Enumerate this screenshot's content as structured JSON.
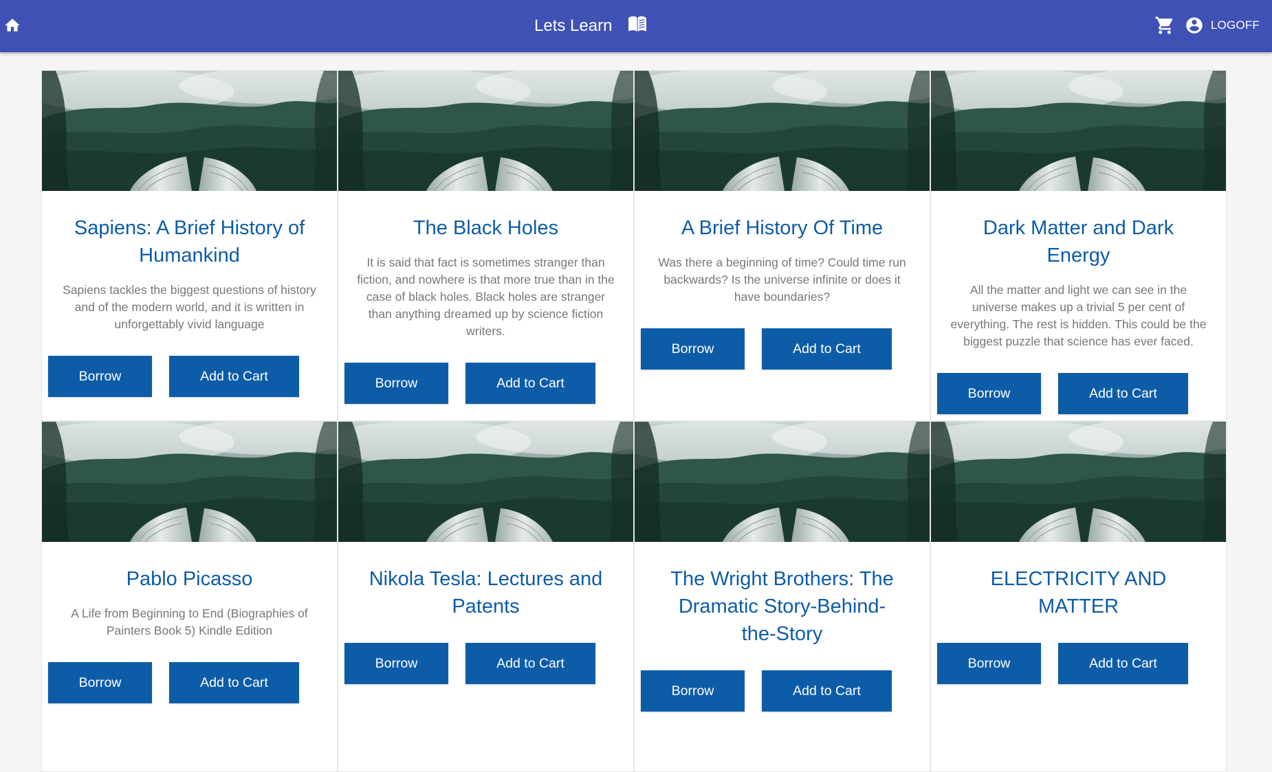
{
  "header": {
    "title": "Lets Learn",
    "icons": [
      "home-icon",
      "open-book-icon",
      "cart-icon",
      "account-circle-icon"
    ],
    "logoff_label": "LOGOFF",
    "bg_color": "#3f51b5"
  },
  "colors": {
    "accent": "#0d5ca8",
    "description": "#777777",
    "page_bg": "#f5f5f5"
  },
  "books": [
    {
      "title": "Sapiens: A Brief History of Humankind",
      "description": "Sapiens tackles the biggest questions of history and of the modern world, and it is written in unforgettably vivid language",
      "borrow_label": "Borrow",
      "cart_label": "Add to Cart"
    },
    {
      "title": "The Black Holes",
      "description": "It is said that fact is sometimes stranger than fiction, and nowhere is that more true than in the case of black holes. Black holes are stranger than anything dreamed up by science fiction writers.",
      "borrow_label": "Borrow",
      "cart_label": "Add to Cart"
    },
    {
      "title": "A Brief History Of Time",
      "description": "Was there a beginning of time? Could time run backwards? Is the universe infinite or does it have boundaries?",
      "borrow_label": "Borrow",
      "cart_label": "Add to Cart"
    },
    {
      "title": "Dark Matter and Dark Energy",
      "description": "All the matter and light we can see in the universe makes up a trivial 5 per cent of everything. The rest is hidden. This could be the biggest puzzle that science has ever faced.",
      "borrow_label": "Borrow",
      "cart_label": "Add to Cart"
    },
    {
      "title": "Pablo Picasso",
      "description": "A Life from Beginning to End (Biographies of Painters Book 5) Kindle Edition",
      "borrow_label": "Borrow",
      "cart_label": "Add to Cart"
    },
    {
      "title": "Nikola Tesla: Lectures and Patents",
      "description": "",
      "borrow_label": "Borrow",
      "cart_label": "Add to Cart"
    },
    {
      "title": "The Wright Brothers: The Dramatic Story-Behind-the-Story",
      "description": "",
      "borrow_label": "Borrow",
      "cart_label": "Add to Cart"
    },
    {
      "title": "ELECTRICITY AND MATTER",
      "description": "",
      "borrow_label": "Borrow",
      "cart_label": "Add to Cart"
    }
  ]
}
